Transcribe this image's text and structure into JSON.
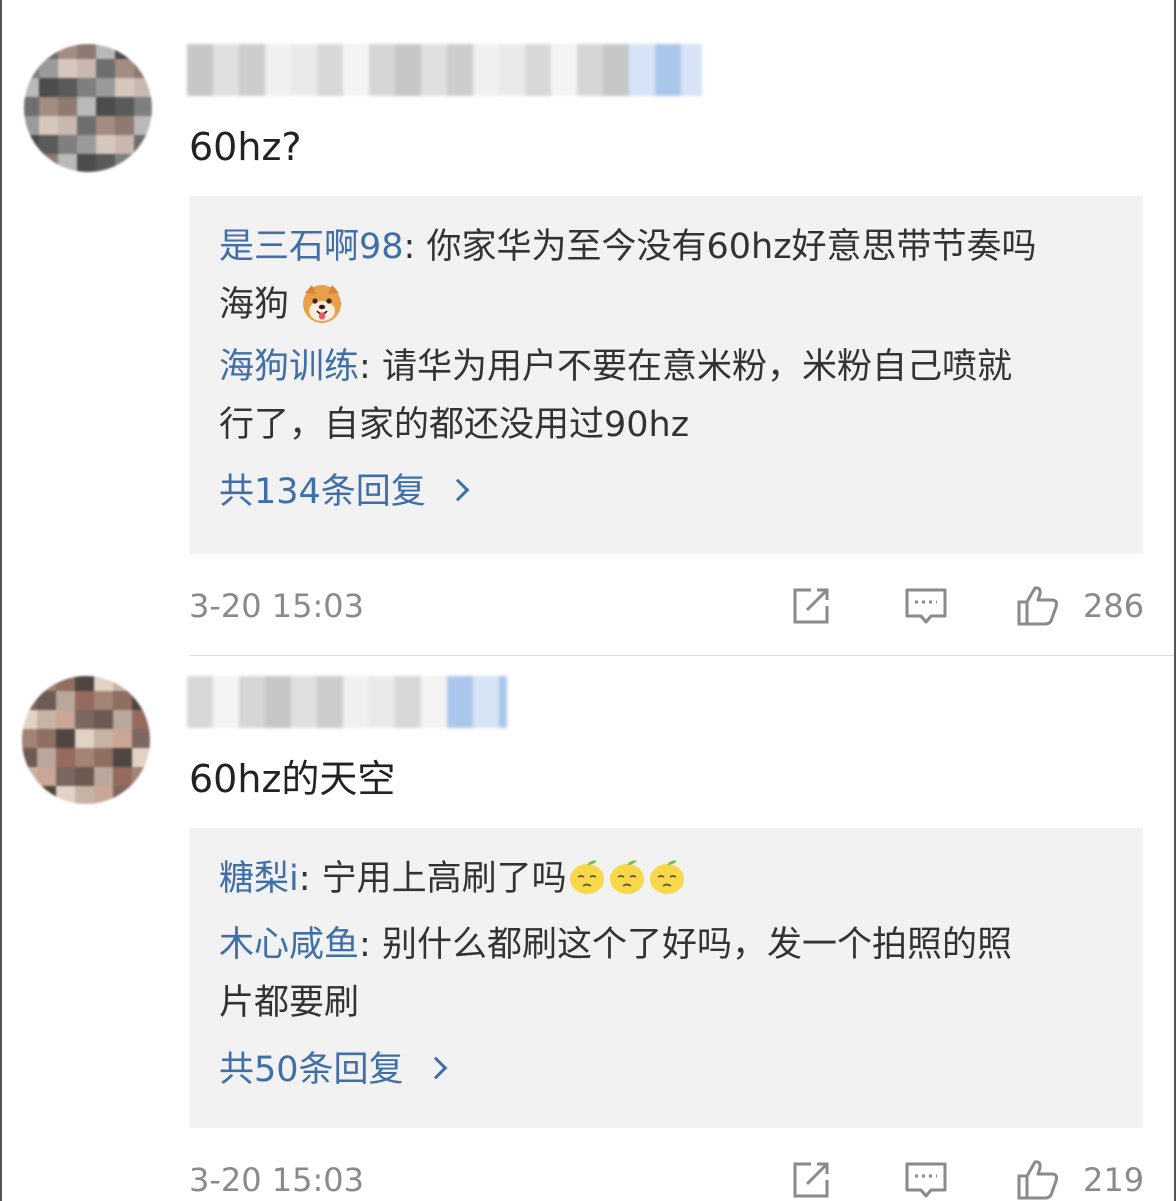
{
  "comments": [
    {
      "text": "60hz?",
      "replies": [
        {
          "name": "是三石啊98",
          "colon": ": ",
          "text": "你家华为至今没有60hz好意思带节奏吗",
          "text2": "海狗",
          "emoji": "shiba-dog-emoji"
        },
        {
          "name": "海狗训练",
          "colon": ": ",
          "text": "请华为用户不要在意米粉，米粉自己喷就",
          "text2": "行了，自家的都还没用过90hz"
        }
      ],
      "more": "共134条回复",
      "timestamp": "3-20 15:03",
      "likes": "286"
    },
    {
      "text": "60hz的天空",
      "replies": [
        {
          "name": "糖梨i",
          "colon": ": ",
          "text": "宁用上高刷了吗",
          "emoji": "lemon-face-emoji"
        },
        {
          "name": "木心咸鱼",
          "colon": ": ",
          "text": "别什么都刷这个了好吗，发一个拍照的照",
          "text2": "片都要刷"
        }
      ],
      "more": "共50条回复",
      "timestamp": "3-20 15:03",
      "likes": "219"
    }
  ],
  "colors": {
    "link": "#3f6ea8",
    "reply_bg": "#f2f2f2",
    "meta": "#8a8a8a"
  }
}
